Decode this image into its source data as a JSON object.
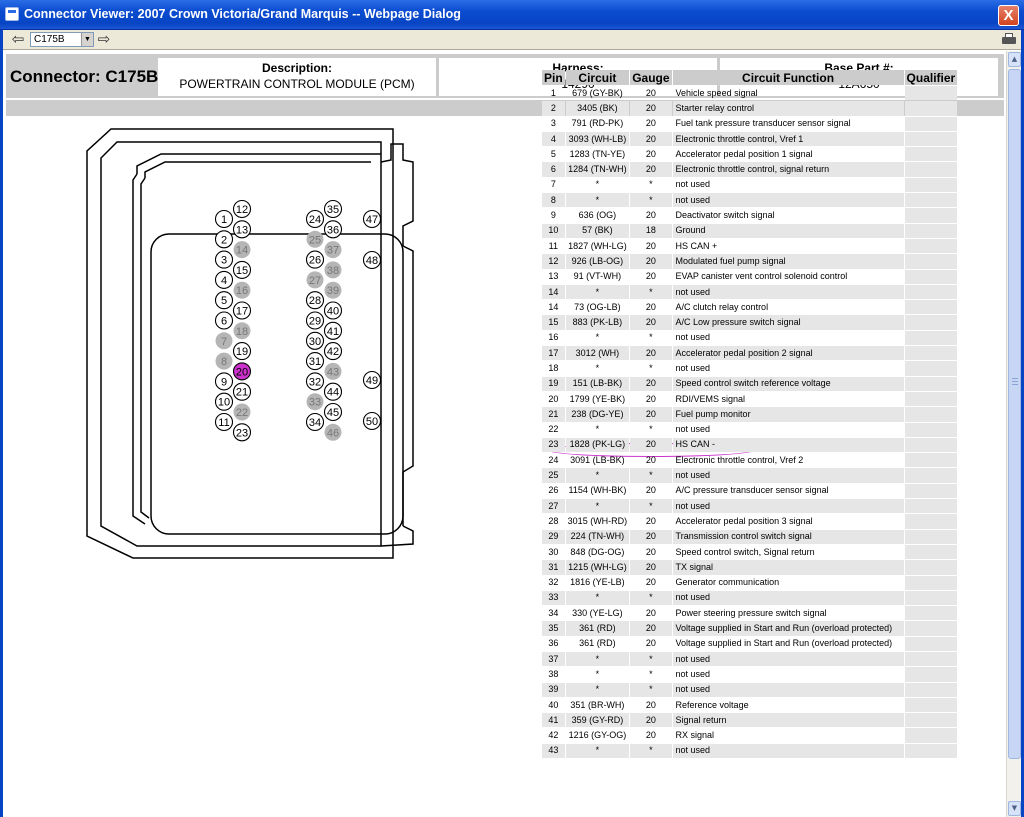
{
  "window": {
    "title": "Connector Viewer: 2007 Crown Victoria/Grand Marquis -- Webpage Dialog",
    "close_glyph": "X"
  },
  "toolbar": {
    "back_icon": "back-arrow-icon",
    "forward_icon": "forward-arrow-icon",
    "connector_select": "C175B",
    "print_icon": "printer-icon"
  },
  "header": {
    "connector_label": "Connector: C175B",
    "description_label": "Description:",
    "description_value": "POWERTRAIN CONTROL MODULE (PCM)",
    "harness_label": "Harness:",
    "harness_value": "14290",
    "base_part_label": "Base Part #:",
    "base_part_value": "12A650"
  },
  "colors": {
    "highlight": "#cc33cc",
    "unused_pin": "#b5b5b5",
    "header_gray": "#cccccc",
    "title_blue": "#0a4bd0"
  },
  "diagram": {
    "highlighted_pin": "20",
    "unused_pins": [
      "7",
      "8",
      "14",
      "16",
      "18",
      "22",
      "25",
      "27",
      "33",
      "37",
      "38",
      "39",
      "43",
      "46"
    ],
    "pins": [
      "1",
      "2",
      "3",
      "4",
      "5",
      "6",
      "7",
      "8",
      "9",
      "10",
      "11",
      "12",
      "13",
      "14",
      "15",
      "16",
      "17",
      "18",
      "19",
      "20",
      "21",
      "22",
      "23",
      "24",
      "25",
      "26",
      "27",
      "28",
      "29",
      "30",
      "31",
      "32",
      "33",
      "34",
      "35",
      "36",
      "37",
      "38",
      "39",
      "40",
      "41",
      "42",
      "43",
      "44",
      "45",
      "46",
      "47",
      "48",
      "49",
      "50"
    ]
  },
  "table": {
    "headers": [
      "Pin",
      "Circuit",
      "Gauge",
      "Circuit Function",
      "Qualifier"
    ],
    "rows": [
      [
        "1",
        "679 (GY-BK)",
        "20",
        "Vehicle speed signal",
        ""
      ],
      [
        "2",
        "3405 (BK)",
        "20",
        "Starter relay control",
        ""
      ],
      [
        "3",
        "791 (RD-PK)",
        "20",
        "Fuel tank pressure transducer sensor signal",
        ""
      ],
      [
        "4",
        "3093 (WH-LB)",
        "20",
        "Electronic throttle control, Vref 1",
        ""
      ],
      [
        "5",
        "1283 (TN-YE)",
        "20",
        "Accelerator pedal position 1 signal",
        ""
      ],
      [
        "6",
        "1284 (TN-WH)",
        "20",
        "Electronic throttle control, signal return",
        ""
      ],
      [
        "7",
        "*",
        "*",
        "not used",
        ""
      ],
      [
        "8",
        "*",
        "*",
        "not used",
        ""
      ],
      [
        "9",
        "636 (OG)",
        "20",
        "Deactivator switch signal",
        ""
      ],
      [
        "10",
        "57 (BK)",
        "18",
        "Ground",
        ""
      ],
      [
        "11",
        "1827 (WH-LG)",
        "20",
        "HS CAN +",
        ""
      ],
      [
        "12",
        "926 (LB-OG)",
        "20",
        "Modulated fuel pump signal",
        ""
      ],
      [
        "13",
        "91 (VT-WH)",
        "20",
        "EVAP canister vent control solenoid control",
        ""
      ],
      [
        "14",
        "*",
        "*",
        "not used",
        ""
      ],
      [
        "14",
        "73 (OG-LB)",
        "20",
        "A/C clutch relay control",
        ""
      ],
      [
        "15",
        "883 (PK-LB)",
        "20",
        "A/C Low pressure switch signal",
        ""
      ],
      [
        "16",
        "*",
        "*",
        "not used",
        ""
      ],
      [
        "17",
        "3012 (WH)",
        "20",
        "Accelerator pedal position 2 signal",
        ""
      ],
      [
        "18",
        "*",
        "*",
        "not used",
        ""
      ],
      [
        "19",
        "151 (LB-BK)",
        "20",
        "Speed control switch reference voltage",
        ""
      ],
      [
        "20",
        "1799 (YE-BK)",
        "20",
        "RDI/VEMS signal",
        ""
      ],
      [
        "21",
        "238 (DG-YE)",
        "20",
        "Fuel pump monitor",
        ""
      ],
      [
        "22",
        "*",
        "*",
        "not used",
        ""
      ],
      [
        "23",
        "1828 (PK-LG)",
        "20",
        "HS CAN -",
        ""
      ],
      [
        "24",
        "3091 (LB-BK)",
        "20",
        "Electronic throttle control, Vref 2",
        ""
      ],
      [
        "25",
        "*",
        "*",
        "not used",
        ""
      ],
      [
        "26",
        "1154 (WH-BK)",
        "20",
        "A/C pressure transducer sensor signal",
        ""
      ],
      [
        "27",
        "*",
        "*",
        "not used",
        ""
      ],
      [
        "28",
        "3015 (WH-RD)",
        "20",
        "Accelerator pedal position 3 signal",
        ""
      ],
      [
        "29",
        "224 (TN-WH)",
        "20",
        "Transmission control switch signal",
        ""
      ],
      [
        "30",
        "848 (DG-OG)",
        "20",
        "Speed control switch, Signal return",
        ""
      ],
      [
        "31",
        "1215 (WH-LG)",
        "20",
        "TX signal",
        ""
      ],
      [
        "32",
        "1816 (YE-LB)",
        "20",
        "Generator communication",
        ""
      ],
      [
        "33",
        "*",
        "*",
        "not used",
        ""
      ],
      [
        "34",
        "330 (YE-LG)",
        "20",
        "Power steering pressure switch signal",
        ""
      ],
      [
        "35",
        "361 (RD)",
        "20",
        "Voltage supplied in Start and Run (overload protected)",
        ""
      ],
      [
        "36",
        "361 (RD)",
        "20",
        "Voltage supplied in Start and Run (overload protected)",
        ""
      ],
      [
        "37",
        "*",
        "*",
        "not used",
        ""
      ],
      [
        "38",
        "*",
        "*",
        "not used",
        ""
      ],
      [
        "39",
        "*",
        "*",
        "not used",
        ""
      ],
      [
        "40",
        "351 (BR-WH)",
        "20",
        "Reference voltage",
        ""
      ],
      [
        "41",
        "359 (GY-RD)",
        "20",
        "Signal return",
        ""
      ],
      [
        "42",
        "1216 (GY-OG)",
        "20",
        "RX signal",
        ""
      ],
      [
        "43",
        "*",
        "*",
        "not used",
        ""
      ]
    ]
  }
}
